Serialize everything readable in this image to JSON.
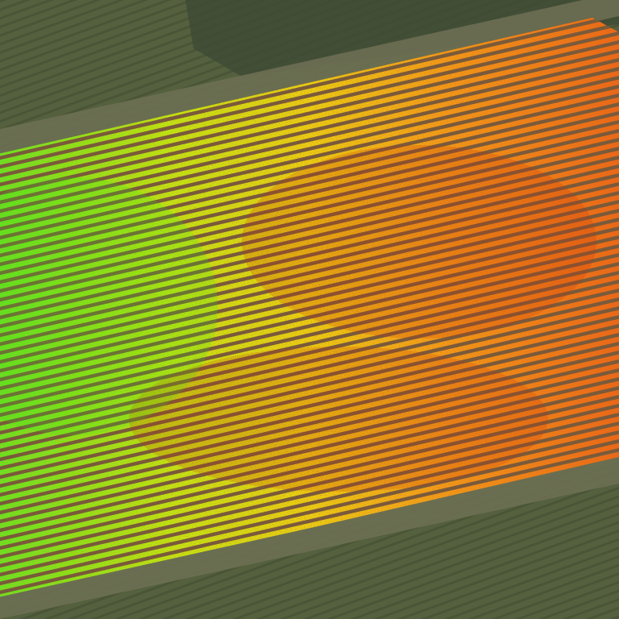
{
  "image": {
    "kind": "aerial-crop-field-vegetation-index-overlay",
    "palette": {
      "background_field": "#59623f",
      "background_field_dark": "#3f4a34",
      "dirt_road": "#6e7155",
      "bare_soil": "#7a5a3a",
      "crop_row_vigorous": "#3ef01a",
      "crop_row_moderate": "#d8f000",
      "crop_row_stressed": "#f08a0a",
      "crop_row_severe": "#d6220a"
    },
    "crop_rows": {
      "orientation": "diagonal-ascending",
      "count_visible": 52
    }
  }
}
